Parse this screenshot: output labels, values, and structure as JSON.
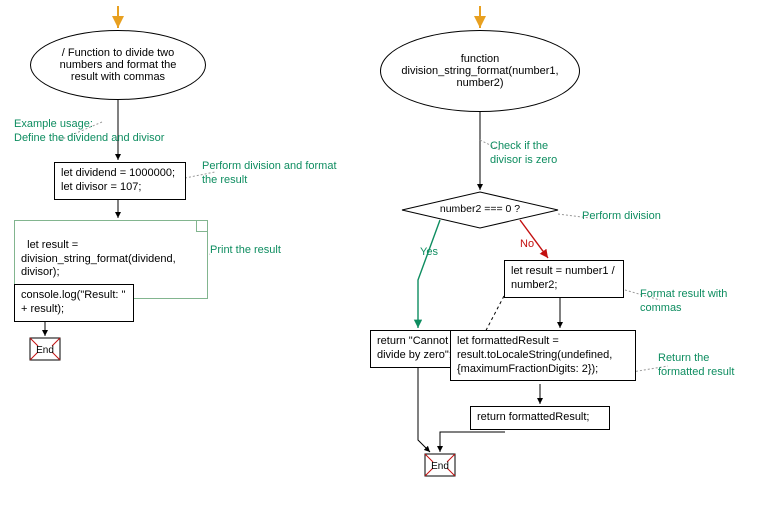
{
  "left": {
    "start_desc": "/ Function to divide two numbers and format the result with commas",
    "anno_example": "Example usage:\nDefine the dividend and divisor",
    "vars": "let dividend = 1000000;\nlet divisor = 107;",
    "anno_perform": "Perform division and format the result",
    "call": "let result = division_string_format(dividend, divisor);",
    "anno_print": "Print the result",
    "log": "console.log(\"Result: \" + result);",
    "end": "End"
  },
  "right": {
    "func": "function division_string_format(number1, number2)",
    "anno_check": "Check if the divisor is zero",
    "cond": "number2 === 0 ?",
    "yes": "Yes",
    "no": "No",
    "anno_perform": "Perform division",
    "return_zero": "return \"Cannot divide by zero\";",
    "calc": "let result = number1 / number2;",
    "anno_format": "Format result with commas",
    "format": "let formattedResult = result.toLocaleString(undefined, {maximumFractionDigits: 2});",
    "anno_return": "Return the formatted result",
    "ret": "return formattedResult;",
    "end": "End"
  }
}
